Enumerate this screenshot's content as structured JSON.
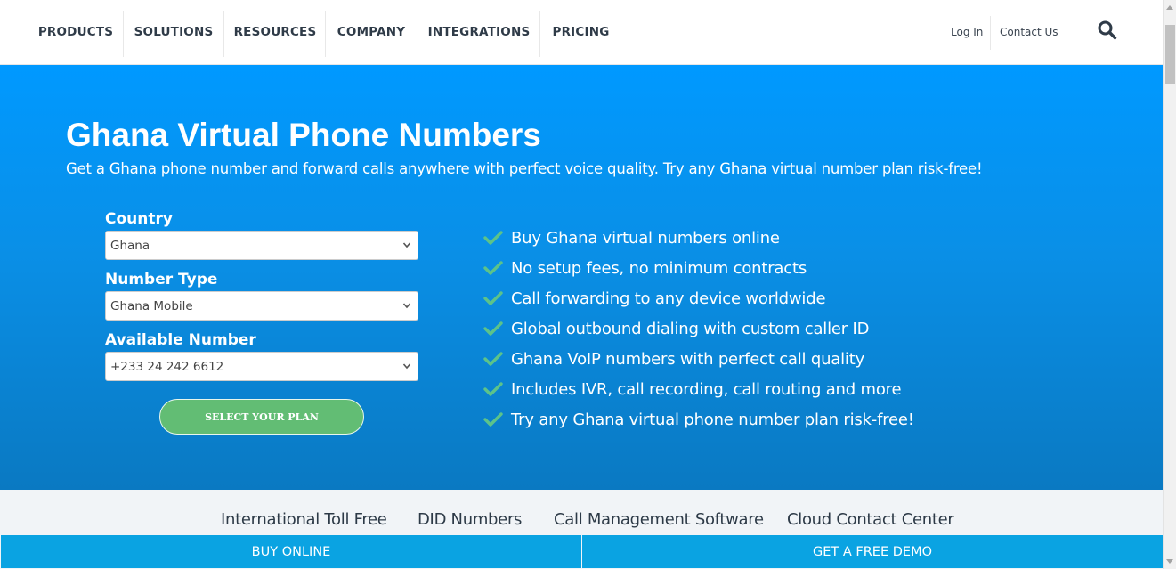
{
  "nav": {
    "items": [
      "PRODUCTS",
      "SOLUTIONS",
      "RESOURCES",
      "COMPANY",
      "INTEGRATIONS",
      "PRICING"
    ],
    "login": "Log In",
    "contact": "Contact Us",
    "search_icon": "search-icon"
  },
  "hero": {
    "title": "Ghana Virtual Phone Numbers",
    "subtitle": "Get a Ghana phone number and forward calls anywhere with perfect voice quality. Try any Ghana virtual number plan risk-free!",
    "background_color": "#0a8fe6"
  },
  "form": {
    "country_label": "Country",
    "country_value": "Ghana",
    "type_label": "Number Type",
    "type_value": "Ghana Mobile",
    "number_label": "Available Number",
    "number_value": "+233 24 242 6612",
    "submit_label": "SELECT YOUR PLAN",
    "submit_color": "#62bd74"
  },
  "features": [
    "Buy Ghana virtual numbers online",
    "No setup fees, no minimum contracts",
    "Call forwarding to any device worldwide",
    "Global outbound dialing with custom caller ID",
    "Ghana VoIP numbers with perfect call quality",
    "Includes IVR, call recording, call routing and more",
    "Try any Ghana virtual phone number plan risk-free!"
  ],
  "products": [
    "International Toll Free",
    "DID Numbers",
    "Call Management Software",
    "Cloud Contact Center"
  ],
  "cta": {
    "buy": "BUY ONLINE",
    "demo": "GET A FREE DEMO",
    "color": "#0aa3e2"
  }
}
